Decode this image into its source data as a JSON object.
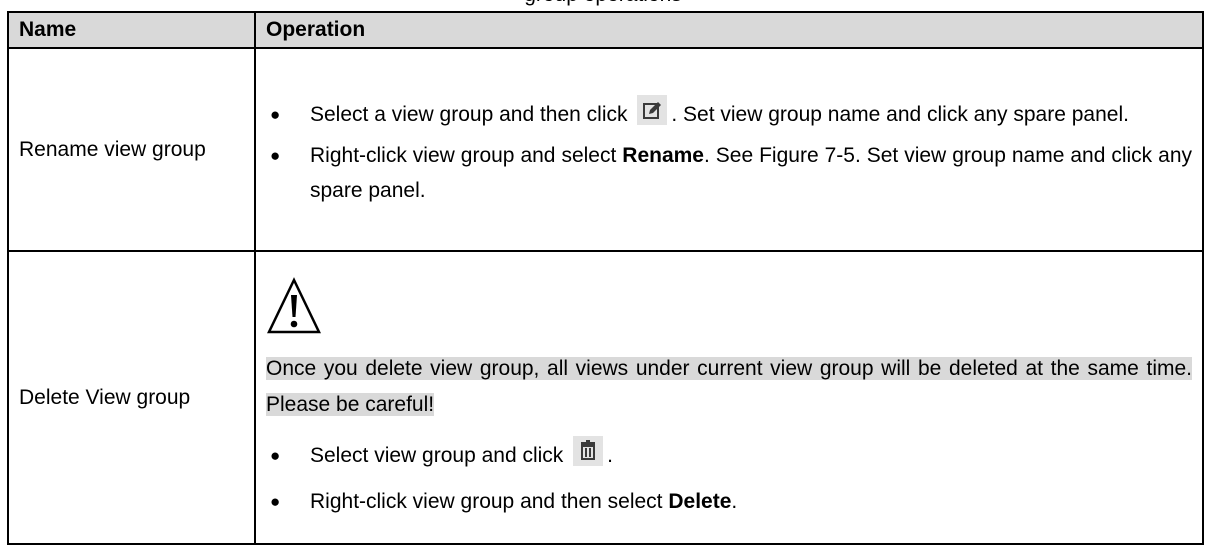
{
  "caption_fragment": "group operations",
  "table": {
    "headers": {
      "name": "Name",
      "operation": "Operation"
    },
    "rename": {
      "name": "Rename view group",
      "bullet1_part1": "Select a view group and then click",
      "bullet1_part2": ". Set view group name and click any spare panel.",
      "bullet2_part1": "Right-click view group and select ",
      "bullet2_bold": "Rename",
      "bullet2_part2": ". See Figure 7-5. Set view group name and click any spare panel.",
      "edit_icon": "edit-icon"
    },
    "delete": {
      "name": "Delete View group",
      "warning_icon": "warning-icon",
      "note": "Once you delete view group, all views under current view group will be deleted at the same time. Please be careful!",
      "bullet1_part1": "Select view group and click",
      "bullet1_part2": ".",
      "bullet2_part1": "Right-click view group and then select ",
      "bullet2_bold": "Delete",
      "bullet2_part2": ".",
      "delete_icon": "trash-icon"
    },
    "bullet_char": "●"
  }
}
